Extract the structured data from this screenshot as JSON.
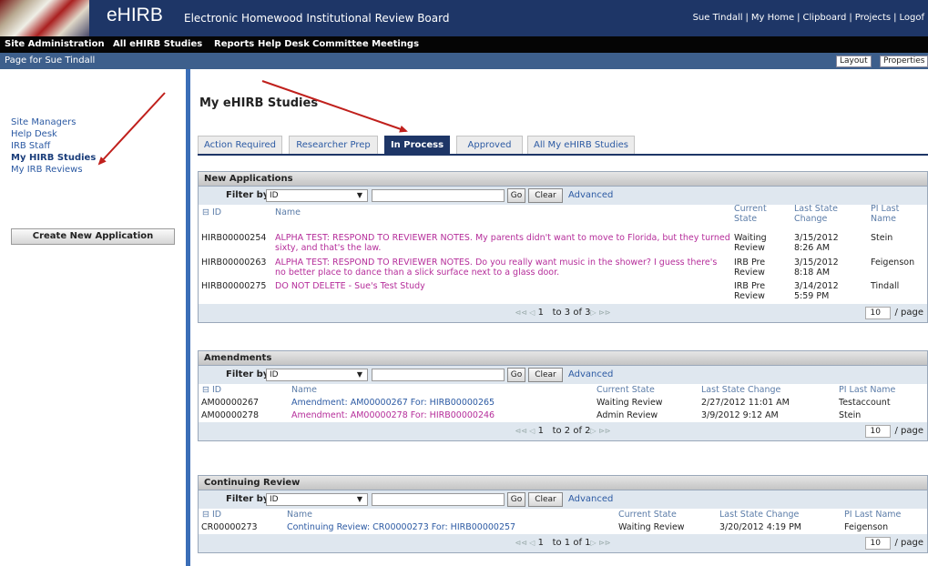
{
  "header": {
    "brand": "eHIRB",
    "title": "Electronic Homewood Institutional Review Board",
    "links": [
      "Sue Tindall",
      "My Home",
      "Clipboard",
      "Projects",
      "Logof"
    ]
  },
  "menu": [
    "Site Administration",
    "All eHIRB Studies",
    "Reports",
    "Help Desk",
    "Committee Meetings"
  ],
  "page_bar": {
    "label": "Page for Sue Tindall",
    "layout_btn": "Layout",
    "properties_btn": "Properties"
  },
  "left_nav": {
    "items": [
      "Site Managers",
      "Help Desk",
      "IRB Staff",
      "My HIRB Studies",
      "My IRB Reviews"
    ],
    "create_button": "Create New Application"
  },
  "main": {
    "title": "My eHIRB Studies",
    "tabs": [
      "Action Required",
      "Researcher Prep",
      "In Process",
      "Approved",
      "All My eHIRB Studies"
    ]
  },
  "common": {
    "filter_label": "Filter by",
    "filter_value": "ID",
    "go": "Go",
    "clear": "Clear",
    "advanced": "Advanced",
    "per_page_value": "10",
    "per_page_label": "/ page"
  },
  "new_apps": {
    "title": "New Applications",
    "headers": {
      "id": "ID",
      "name": "Name",
      "state": "Current State",
      "change": "Last State Change",
      "pi": "PI Last Name"
    },
    "rows": [
      {
        "id": "HIRB00000254",
        "name": "ALPHA TEST: RESPOND TO REVIEWER NOTES. My parents didn't want to move to Florida, but they turned sixty, and that's the law.",
        "state": "Waiting Review",
        "change": "3/15/2012 8:26 AM",
        "pi": "Stein"
      },
      {
        "id": "HIRB00000263",
        "name": "ALPHA TEST: RESPOND TO REVIEWER NOTES. Do you really want music in the shower? I guess there's no better place to dance than a slick surface next to a glass door.",
        "state": "IRB Pre Review",
        "change": "3/15/2012 8:18 AM",
        "pi": "Feigenson"
      },
      {
        "id": "HIRB00000275",
        "name": "DO NOT DELETE - Sue's Test Study",
        "state": "IRB Pre Review",
        "change": "3/14/2012 5:59 PM",
        "pi": "Tindall"
      }
    ],
    "page_num": "1",
    "page_of": "to 3 of 3"
  },
  "amendments": {
    "title": "Amendments",
    "headers": {
      "id": "ID",
      "name": "Name",
      "state": "Current State",
      "change": "Last State Change",
      "pi": "PI Last Name"
    },
    "rows": [
      {
        "id": "AM00000267",
        "name": "Amendment: AM00000267 For: HIRB00000265",
        "state": "Waiting Review",
        "change": "2/27/2012 11:01 AM",
        "pi": "Testaccount"
      },
      {
        "id": "AM00000278",
        "name": "Amendment: AM00000278 For: HIRB00000246",
        "state": "Admin Review",
        "change": "3/9/2012 9:12 AM",
        "pi": "Stein"
      }
    ],
    "page_num": "1",
    "page_of": "to 2 of 2"
  },
  "continuing": {
    "title": "Continuing Review",
    "headers": {
      "id": "ID",
      "name": "Name",
      "state": "Current State",
      "change": "Last State Change",
      "pi": "PI Last Name"
    },
    "rows": [
      {
        "id": "CR00000273",
        "name": "Continuing Review: CR00000273 For: HIRB00000257",
        "state": "Waiting Review",
        "change": "3/20/2012 4:19 PM",
        "pi": "Feigenson"
      }
    ],
    "page_num": "1",
    "page_of": "to 1 of 1"
  },
  "colors": {
    "navy": "#1e3667",
    "link_blue": "#2c5aa3",
    "magenta": "#b52d9a",
    "annotation_red": "#c0201c"
  }
}
